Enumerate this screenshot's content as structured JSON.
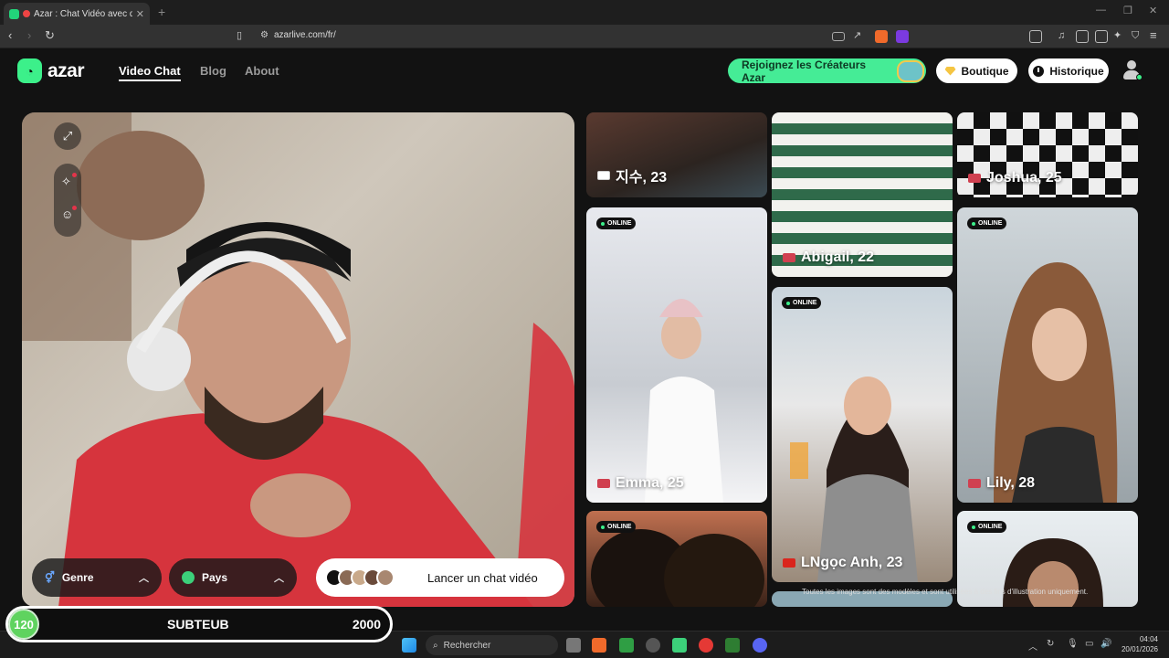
{
  "browser": {
    "tab_title": "Azar : Chat Vidéo avec de no",
    "url": "azarlive.com/fr/"
  },
  "site": {
    "logo": "azar",
    "nav": [
      "Video Chat",
      "Blog",
      "About"
    ],
    "creators_button": "Rejoignez les Créateurs Azar",
    "shop_button": "Boutique",
    "history_button": "Historique"
  },
  "video": {
    "genre_label": "Genre",
    "country_label": "Pays",
    "launch_label": "Lancer un chat vidéo"
  },
  "profiles": [
    {
      "name": "지수, 23",
      "flag": "kr",
      "online": false
    },
    {
      "name": "Abigail, 22",
      "flag": "us",
      "online": false
    },
    {
      "name": "Joshua, 25",
      "flag": "us",
      "online": false
    },
    {
      "name": "Emma, 25",
      "flag": "us",
      "online": true
    },
    {
      "name": "LNgọc Anh, 23",
      "flag": "vn",
      "online": true
    },
    {
      "name": "Lily, 28",
      "flag": "us",
      "online": true
    },
    {
      "name": "",
      "flag": "",
      "online": true
    },
    {
      "name": "",
      "flag": "",
      "online": true
    },
    {
      "name": "",
      "flag": "",
      "online": true
    }
  ],
  "online_label": "ONLINE",
  "disclaimer": "Toutes les images sont des modèles et sont utilisées à des fins d'illustration uniquement.",
  "stream_overlay": {
    "level": "120",
    "name": "SUBTEUB",
    "value": "2000"
  },
  "taskbar": {
    "search_placeholder": "Rechercher",
    "time": "04:04",
    "date": "20/01/2026"
  },
  "colors": {
    "accent": "#45ec96",
    "background": "#121212"
  }
}
